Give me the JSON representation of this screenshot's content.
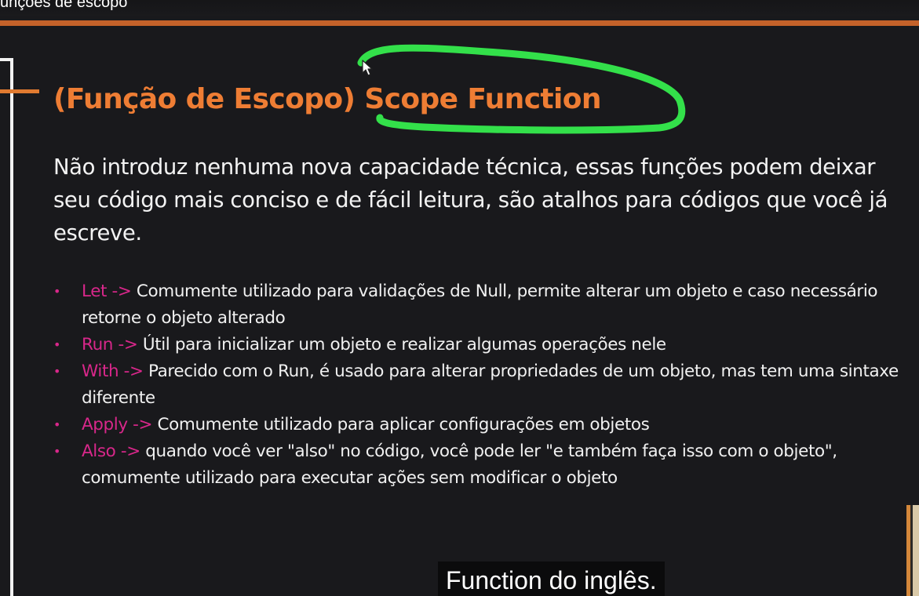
{
  "video": {
    "title": "unções de escopo"
  },
  "slide": {
    "title_pt": "(Função de Escopo)",
    "title_en": "Scope Function",
    "intro": "Não introduz nenhuma nova capacidade técnica, essas funções podem deixar seu código mais conciso e de fácil leitura, são atalhos para códigos que você já escreve.",
    "bullet_marker": "•",
    "bullets": [
      {
        "keyword": "Let ->",
        "text": " Comumente utilizado para validações de Null, permite alterar um objeto e caso necessário retorne o objeto alterado"
      },
      {
        "keyword": "Run ->",
        "text": " Útil para inicializar um objeto e realizar algumas operações nele"
      },
      {
        "keyword": "With ->",
        "text": " Parecido com o Run, é usado para alterar propriedades de um objeto, mas tem uma sintaxe diferente"
      },
      {
        "keyword": "Apply ->",
        "text": " Comumente utilizado para aplicar configurações em objetos"
      },
      {
        "keyword": "Also ->",
        "text": " quando você ver \"also\" no código, você pode ler \"e também faça isso com o objeto\", comumente utilizado para executar ações sem modificar o objeto"
      }
    ]
  },
  "caption": {
    "text": "Function do inglês."
  },
  "colors": {
    "background": "#19191c",
    "accent_orange": "#ee7d34",
    "accent_pink": "#d8278a",
    "annotation_green": "#33e04a",
    "text": "#f3f3f3"
  },
  "icons": {
    "cursor": "mouse-pointer-icon",
    "bullet": "bullet-dot-icon"
  }
}
